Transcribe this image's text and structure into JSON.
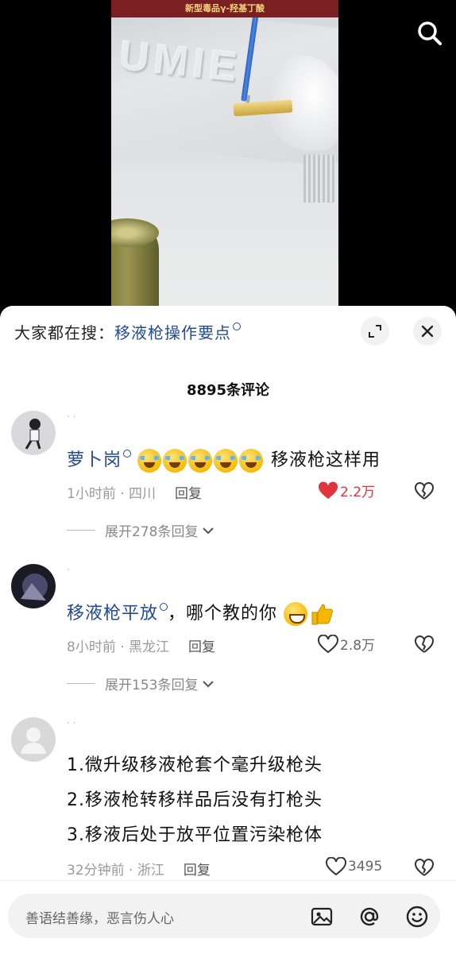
{
  "video": {
    "banner_text": "新型毒品γ-羟基丁酸",
    "laptop_logo_text": "UMIE"
  },
  "top_bar": {
    "search_icon": "search-icon"
  },
  "sheet": {
    "hot_search_prefix": "大家都在搜：",
    "hot_search_term": "移液枪操作要点",
    "comment_count": "8895条评论",
    "expand_icon": "expand-icon",
    "close_icon": "close-icon"
  },
  "comments": [
    {
      "username": "· ·",
      "mention": "萝卜岗",
      "emoji": "laughing-crying-emoji x5",
      "text_after": "移液枪这样用",
      "time_location": "1小时前 · 四川",
      "reply_label": "回复",
      "likes": "2.2万",
      "liked": true,
      "expand_label": "展开278条回复"
    },
    {
      "username": "·",
      "mention": "移液枪平放",
      "text_after": "，哪个教的你",
      "emoji": "grin-sweat-emoji, thumbs-up-emoji",
      "time_location": "8小时前 · 黑龙江",
      "reply_label": "回复",
      "likes": "2.8万",
      "liked": false,
      "expand_label": "展开153条回复"
    },
    {
      "username": "· ·",
      "lines": [
        "1.微升级移液枪套个毫升级枪头",
        "2.移液枪转移样品后没有打枪头",
        "3.移液后处于放平位置污染枪体"
      ],
      "time_location": "32分钟前 · 浙江",
      "reply_label": "回复",
      "likes": "3495",
      "liked": false
    }
  ],
  "input_bar": {
    "placeholder": "善语结善缘，恶言伤人心",
    "image_icon": "image-icon",
    "at_icon": "at-icon",
    "emoji_icon": "emoji-icon"
  },
  "colors": {
    "link_blue": "#244a8f",
    "like_red": "#e0353f",
    "banner_red": "#7a1f22"
  }
}
